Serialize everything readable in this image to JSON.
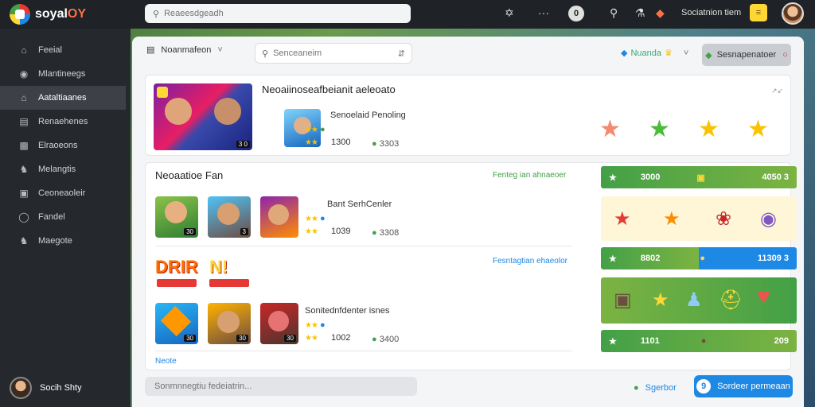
{
  "app": {
    "name_a": "soyal",
    "name_b": "OY"
  },
  "topbar": {
    "search_placeholder": "Reaeesdgeadh",
    "coins": "0",
    "user_label": "Sociatnion tiem",
    "gold_label": "≡"
  },
  "sidebar": {
    "items": [
      {
        "label": "Feeial",
        "icon": "home-icon"
      },
      {
        "label": "Mlantineegs",
        "icon": "compass-icon"
      },
      {
        "label": "Aataltiaanes",
        "icon": "house-icon"
      },
      {
        "label": "Renaehenes",
        "icon": "grid-icon"
      },
      {
        "label": "Elraoeons",
        "icon": "chart-icon"
      },
      {
        "label": "Melangtis",
        "icon": "trophy-icon"
      },
      {
        "label": "Ceoneaoleir",
        "icon": "controller-icon"
      },
      {
        "label": "Fandel",
        "icon": "target-icon"
      },
      {
        "label": "Maegote",
        "icon": "trophy-icon"
      }
    ],
    "active_index": 2,
    "user": "Socih Shty"
  },
  "toolbar": {
    "title": "Noanmafeon",
    "search_placeholder": "Senceaneim",
    "right_label": "Nuanda",
    "button_label": "Sesnapenatoer"
  },
  "featured": {
    "heading": "Neoaiinoseafbeianit aeleoato",
    "badge": "3 0",
    "game_title": "Senoelaid Penoling",
    "score": "1300",
    "right_value": "3303",
    "stars_colors": [
      "#f48a6d",
      "#4cbb3a",
      "#f9c300",
      "#f9c300"
    ]
  },
  "list": {
    "heading": "Neoaatioe Fan",
    "link1": "Fenteg ian ahnaeoer",
    "link2": "Fesntagtian ehaeolor",
    "footer_link": "Neote",
    "rows": [
      {
        "title": "Bant SerhCenler",
        "score": "1039",
        "right": "3308"
      },
      {
        "title": "Sonitednfdenter isnes",
        "score": "1002",
        "right": "3400"
      }
    ],
    "thumb_badges": [
      "30",
      "3",
      "30",
      "30",
      "30"
    ],
    "logo_a": "DRIR",
    "logo_b": "N!"
  },
  "right_bars": [
    {
      "left": "3000",
      "right": "4050 3"
    },
    {
      "left": "8802",
      "right": "11309 3"
    },
    {
      "left": "1101",
      "right": "209"
    }
  ],
  "bottom": {
    "search_placeholder": "Sonmnnegtiu fedeiatrin...",
    "link_label": "Sgerbor",
    "button_label": "Sordeer permeaan",
    "button_icon_text": "9"
  }
}
